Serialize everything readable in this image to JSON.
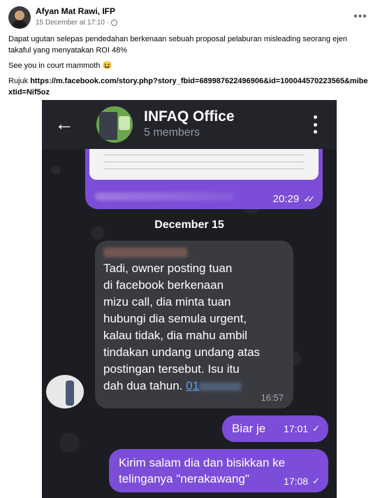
{
  "post": {
    "author": "Afyan Mat Rawi, IFP",
    "timestamp": "15 December at 17:10 ·",
    "privacy_icon": "globe-icon",
    "paragraphs": [
      "Dapat ugutan selepas pendedahan berkenaan sebuah proposal pelaburan misleading seorang ejen takaful yang menyatakan ROI 48%",
      "See you in court mammoth 😆"
    ],
    "rujuk_label": "Rujuk",
    "link_text": "https://m.facebook.com/story.php?story_fbid=689987622496906&id=100044570223565&mibextid=Nif5oz",
    "more_label": "•••"
  },
  "chat": {
    "back_label": "←",
    "group_name": "INFAQ Office",
    "members": "5 members",
    "image_message": {
      "time": "20:29",
      "ticks": "✓✓"
    },
    "date_divider": "December 15",
    "incoming": {
      "text": "Tadi, owner posting tuan\ndi facebook berkenaan\nmizu call, dia minta tuan\nhubungi dia semula urgent,\nkalau tidak, dia mahu ambil\ntindakan undang undang atas\npostingan tersebut. Isu itu\ndah dua tahun. ",
      "phone_visible": "01",
      "time": "16:57"
    },
    "outgoing": [
      {
        "text": "Biar je",
        "time": "17:01",
        "check": "✓"
      },
      {
        "text": "Kirim salam dia dan bisikkan ke\ntelinganya \"nerakawang\"",
        "time": "17:08",
        "check": "✓"
      }
    ]
  },
  "colors": {
    "chat_bg": "#1c1d22",
    "outgoing_bubble": "#7c4dd8",
    "incoming_bubble": "#3a3b41",
    "link_blue": "#5aa2ff"
  }
}
